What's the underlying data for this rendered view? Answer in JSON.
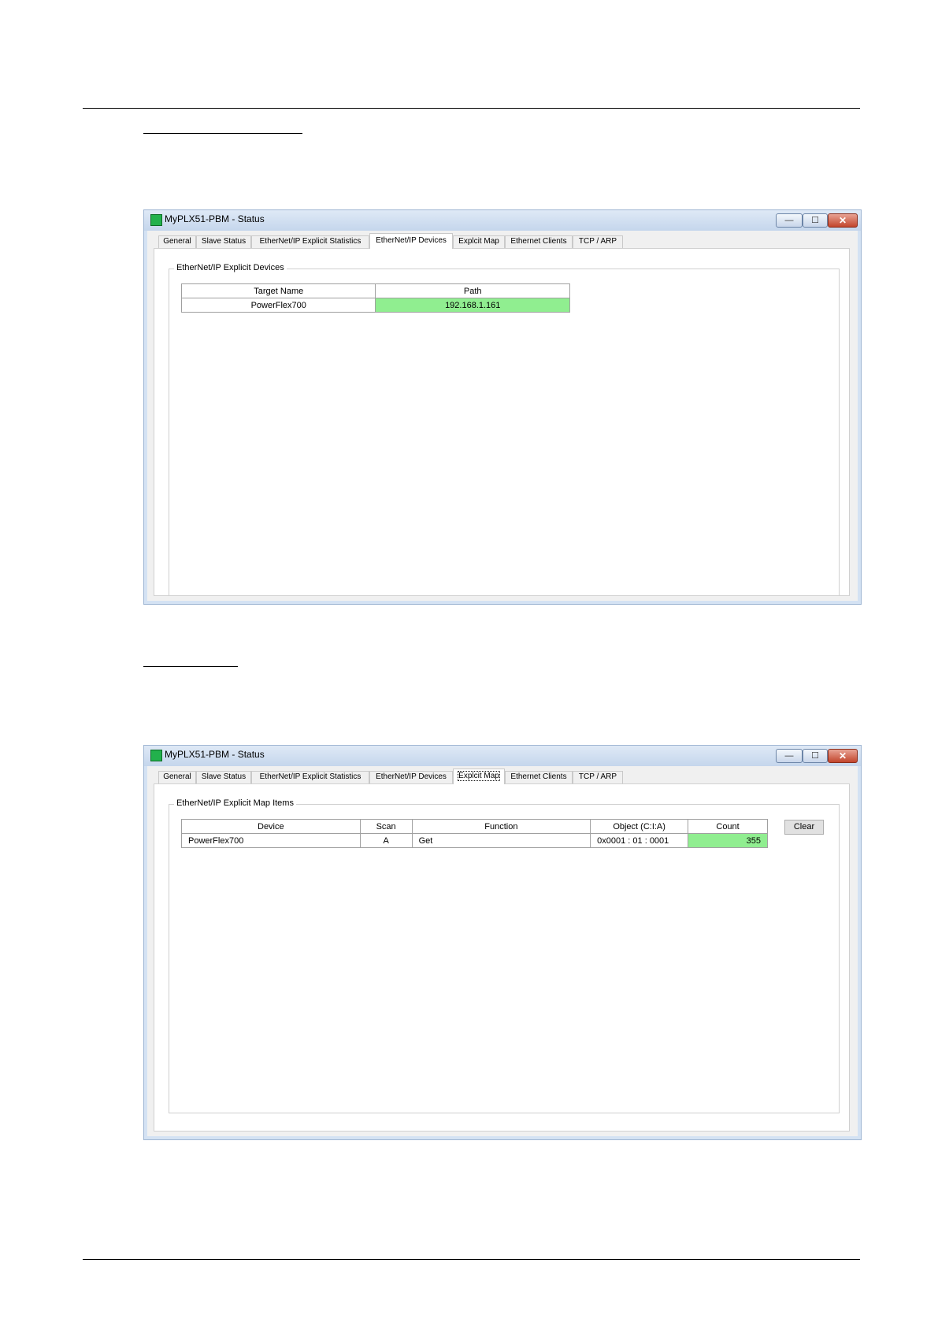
{
  "figure1": {
    "window_title": "MyPLX51-PBM - Status",
    "window_controls": {
      "minimize": "—",
      "maximize": "☐",
      "close": "✕"
    },
    "tabs": [
      "General",
      "Slave Status",
      "EtherNet/IP Explicit Statistics",
      "EtherNet/IP Devices",
      "Explcit Map",
      "Ethernet Clients",
      "TCP / ARP"
    ],
    "active_tab": "EtherNet/IP Devices",
    "group_label": "EtherNet/IP Explicit Devices",
    "columns": [
      "Target Name",
      "Path"
    ],
    "rows": [
      {
        "target_name": "PowerFlex700",
        "path": "192.168.1.161"
      }
    ],
    "status_color": "#90ee90"
  },
  "figure2": {
    "window_title": "MyPLX51-PBM - Status",
    "window_controls": {
      "minimize": "—",
      "maximize": "☐",
      "close": "✕"
    },
    "tabs": [
      "General",
      "Slave Status",
      "EtherNet/IP Explicit Statistics",
      "EtherNet/IP Devices",
      "Explcit Map",
      "Ethernet Clients",
      "TCP / ARP"
    ],
    "active_tab": "Explcit Map",
    "group_label": "EtherNet/IP Explicit Map Items",
    "columns": [
      "Device",
      "Scan",
      "Function",
      "Object (C:I:A)",
      "Count"
    ],
    "rows": [
      {
        "device": "PowerFlex700",
        "scan": "A",
        "function": "Get",
        "object": "0x0001 : 01 : 0001",
        "count": "355"
      }
    ],
    "clear_label": "Clear",
    "status_color": "#90ee90"
  }
}
